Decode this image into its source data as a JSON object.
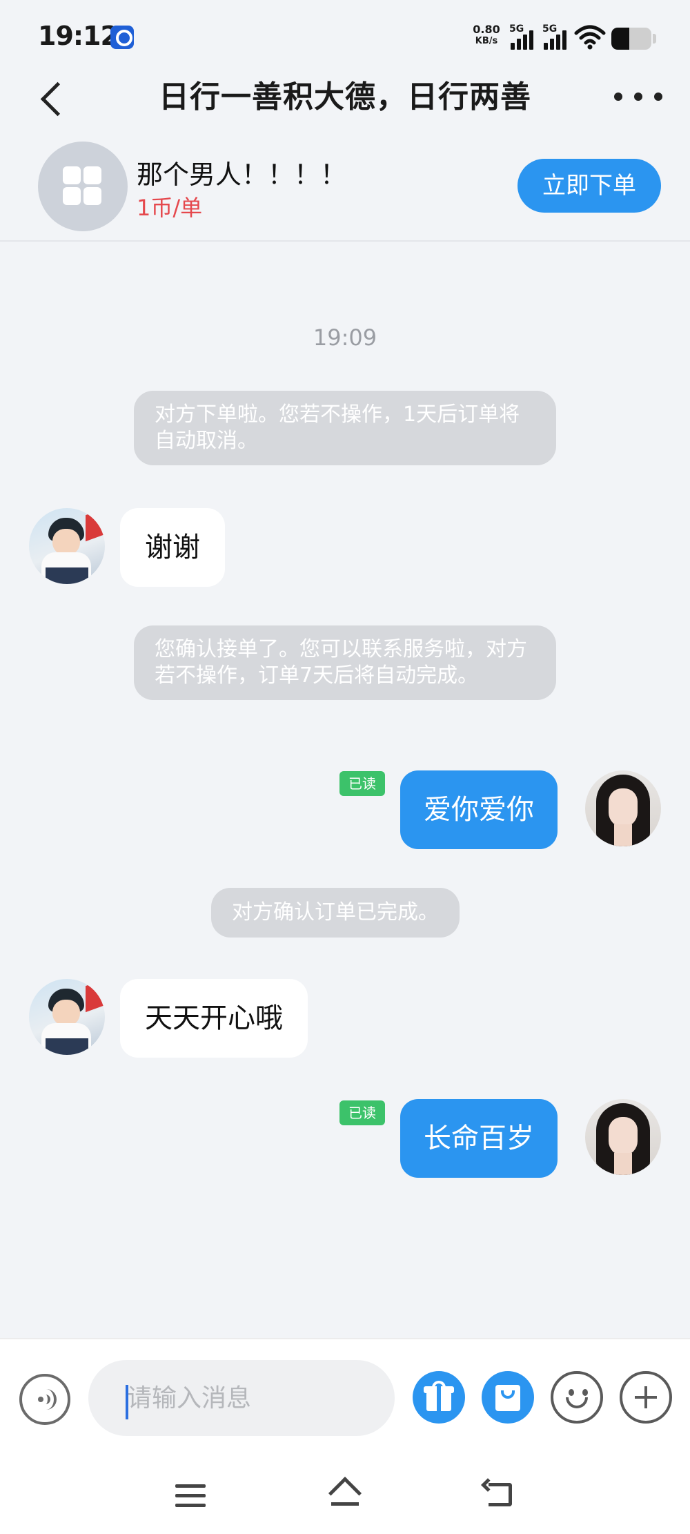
{
  "status_bar": {
    "time": "19:12",
    "net_speed_value": "0.80",
    "net_speed_unit": "KB/s",
    "signal_1_label": "5G",
    "signal_2_label": "5G",
    "battery_level": 0.45
  },
  "header": {
    "title": "日行一善积大德，日行两善"
  },
  "product": {
    "name": "那个男人！！！！",
    "price": "1币/单",
    "order_button": "立即下单"
  },
  "chat": {
    "timestamp": "19:09",
    "messages": [
      {
        "type": "system",
        "text": "对方下单啦。您若不操作，1天后订单将自动取消。"
      },
      {
        "type": "incoming",
        "text": "谢谢"
      },
      {
        "type": "system",
        "text": "您确认接单了。您可以联系服务啦，对方若不操作，订单7天后将自动完成。"
      },
      {
        "type": "outgoing",
        "text": "爱你爱你",
        "read_label": "已读"
      },
      {
        "type": "system",
        "text": "对方确认订单已完成。"
      },
      {
        "type": "incoming",
        "text": "天天开心哦"
      },
      {
        "type": "outgoing",
        "text": "长命百岁",
        "read_label": "已读"
      }
    ]
  },
  "input_bar": {
    "placeholder": "请输入消息"
  },
  "colors": {
    "accent": "#2b95f0",
    "price": "#e5484d",
    "read_badge": "#3cc26a",
    "system_bubble": "#d6d8dc",
    "background": "#f2f4f7"
  },
  "icons": {
    "back": "chevron-left-icon",
    "more": "more-dots-icon",
    "voice": "voice-icon",
    "gift": "gift-icon",
    "pack": "red-packet-icon",
    "emoji": "emoji-icon",
    "plus": "plus-icon"
  }
}
